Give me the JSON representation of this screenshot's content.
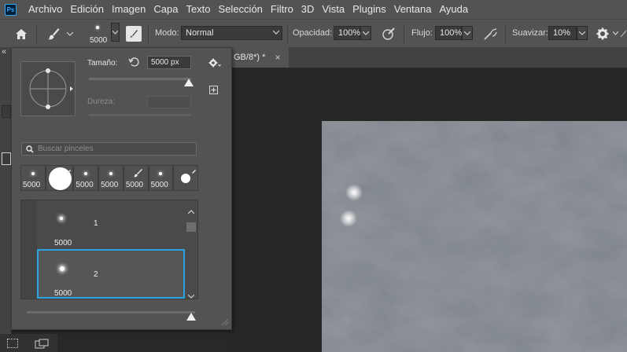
{
  "app": {
    "logo": "Ps"
  },
  "menu": [
    "Archivo",
    "Edición",
    "Imagen",
    "Capa",
    "Texto",
    "Selección",
    "Filtro",
    "3D",
    "Vista",
    "Plugins",
    "Ventana",
    "Ayuda"
  ],
  "options": {
    "brush_size_label": "5000",
    "mode_label": "Modo:",
    "mode_value": "Normal",
    "opacity_label": "Opacidad:",
    "opacity_value": "100%",
    "flow_label": "Flujo:",
    "flow_value": "100%",
    "smoothing_label": "Suavizar:",
    "smoothing_value": "10%"
  },
  "panel_collapse": "«",
  "document": {
    "tab_title": "GB/8*) *",
    "close_glyph": "×"
  },
  "brush_panel": {
    "size_label": "Tamaño:",
    "size_value": "5000 px",
    "hardness_label": "Dureza:",
    "search_placeholder": "Buscar pinceles",
    "presets": [
      "5000",
      "",
      "5000",
      "5000",
      "5000",
      "5000",
      ""
    ],
    "brushes": [
      {
        "size": "5000",
        "name": "1",
        "selected": false
      },
      {
        "size": "5000",
        "name": "2",
        "selected": true
      }
    ]
  },
  "colors": {
    "accent": "#2ca4e0",
    "panel_bg": "#535353",
    "canvas_bg": "#262626"
  }
}
